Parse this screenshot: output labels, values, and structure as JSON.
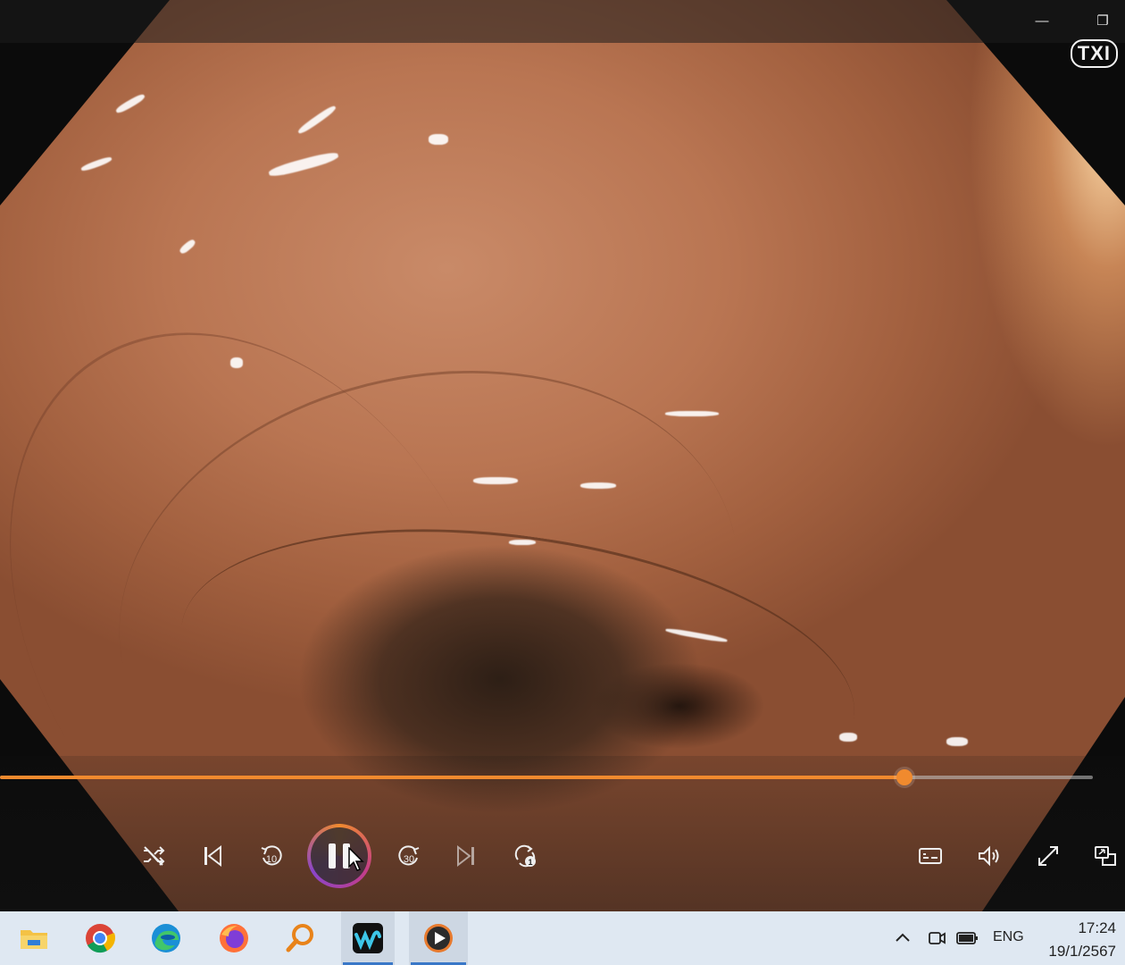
{
  "window": {
    "minimize_glyph": "—",
    "restore_glyph": "❐",
    "overlay_badge": "TXI"
  },
  "player": {
    "progress_fraction": 0.828,
    "accent_color": "#f08a2e",
    "controls": [
      {
        "name": "shuffle-button",
        "icon": "shuffle-icon"
      },
      {
        "name": "previous-button",
        "icon": "skip-previous-icon"
      },
      {
        "name": "rewind-10-button",
        "icon": "rewind-10-icon",
        "label": "10"
      },
      {
        "name": "pause-button",
        "icon": "pause-icon"
      },
      {
        "name": "forward-30-button",
        "icon": "forward-30-icon",
        "label": "30"
      },
      {
        "name": "next-button",
        "icon": "skip-next-icon"
      },
      {
        "name": "repeat-button",
        "icon": "repeat-one-icon",
        "label": "1"
      },
      {
        "name": "subtitles-button",
        "icon": "captions-icon"
      },
      {
        "name": "volume-button",
        "icon": "speaker-icon"
      },
      {
        "name": "fullscreen-button",
        "icon": "expand-icon"
      },
      {
        "name": "miniplayer-button",
        "icon": "miniplayer-icon"
      }
    ]
  },
  "taskbar": {
    "apps": [
      {
        "name": "file-explorer",
        "icon": "folder-icon"
      },
      {
        "name": "chrome",
        "icon": "chrome-icon"
      },
      {
        "name": "edge",
        "icon": "edge-icon"
      },
      {
        "name": "firefox",
        "icon": "firefox-icon"
      },
      {
        "name": "search-app",
        "icon": "magnifier-icon"
      },
      {
        "name": "webex",
        "icon": "webex-icon"
      },
      {
        "name": "media-player",
        "icon": "media-player-icon"
      }
    ],
    "tray": {
      "language": "ENG",
      "time": "17:24",
      "date": "19/1/2567"
    }
  }
}
